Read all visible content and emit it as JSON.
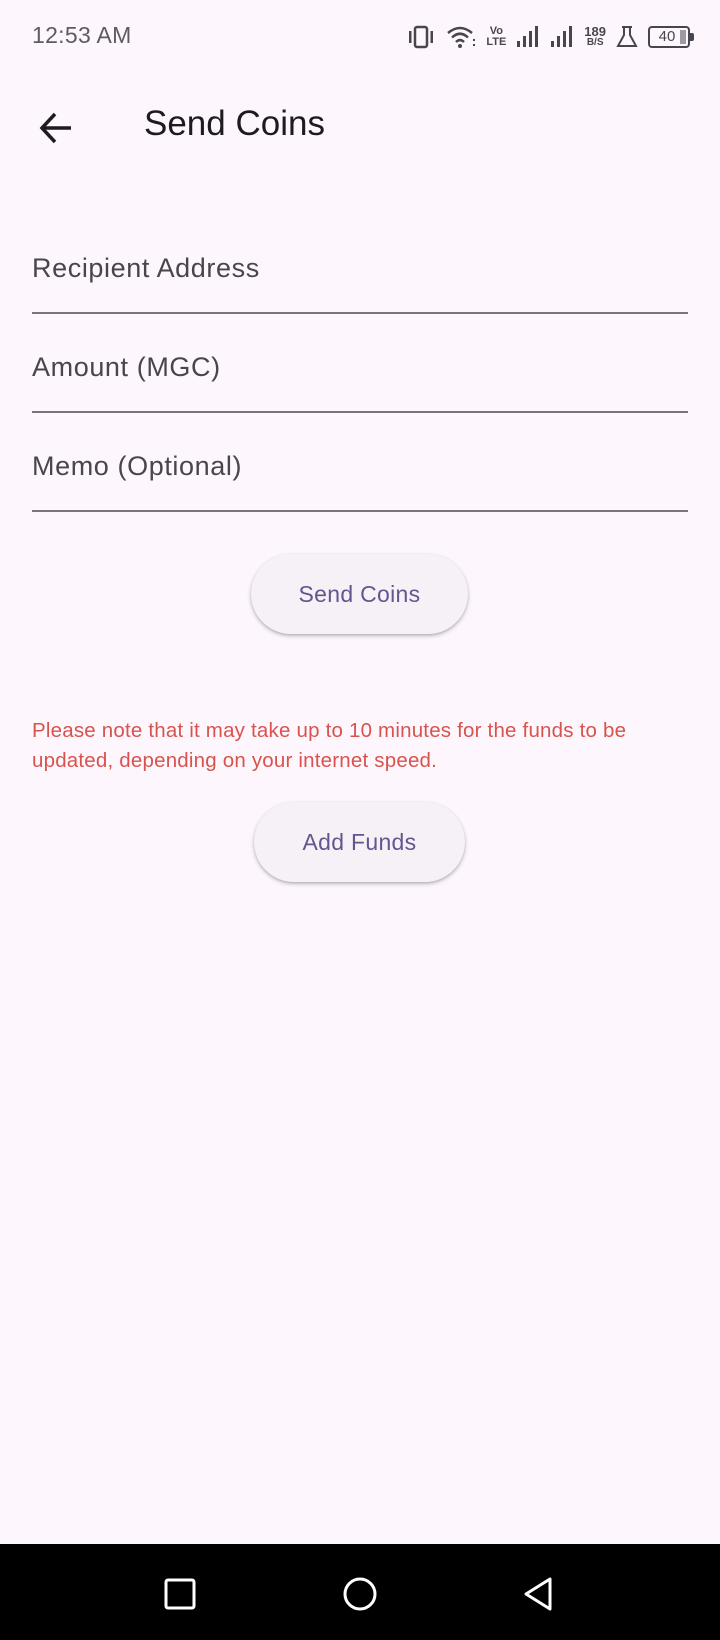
{
  "status_bar": {
    "time": "12:53 AM",
    "network_speed_value": "189",
    "network_speed_unit": "B/S",
    "volte_top": "Vo",
    "volte_bottom": "LTE",
    "battery_level": "40",
    "icons": [
      "vibrate-icon",
      "wifi-icon",
      "volte-icon",
      "signal-icon",
      "signal-icon",
      "network-speed-icon",
      "flask-icon",
      "battery-icon"
    ]
  },
  "app_bar": {
    "title": "Send Coins"
  },
  "form": {
    "recipient_placeholder": "Recipient Address",
    "amount_placeholder": "Amount (MGC)",
    "memo_placeholder": "Memo (Optional)",
    "recipient_value": "",
    "amount_value": "",
    "memo_value": ""
  },
  "buttons": {
    "send_label": "Send Coins",
    "add_funds_label": "Add Funds"
  },
  "notice": "Please note that it may take up to 10 minutes for the funds to be updated, depending on your internet speed.",
  "colors": {
    "background": "#fdf7fd",
    "button_bg": "#f6f1f7",
    "button_text": "#65558f",
    "notice_text": "#d8534d",
    "nav_bar": "#000000"
  },
  "nav_bar": {
    "buttons": [
      "recents-icon",
      "home-icon",
      "back-triangle-icon"
    ]
  }
}
